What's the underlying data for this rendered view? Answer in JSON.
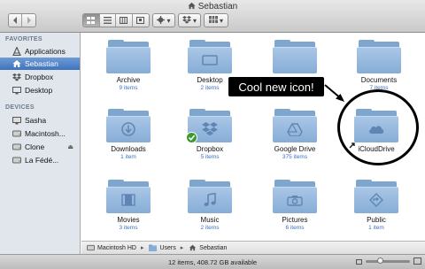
{
  "window": {
    "title": "Sebastian"
  },
  "toolbar": {
    "back_icon": "chevron-left-icon",
    "forward_icon": "chevron-right-icon",
    "view_modes": [
      "icon-view-icon",
      "list-view-icon",
      "column-view-icon",
      "cover-flow-icon"
    ],
    "action_icon": "gear-icon",
    "dropbox_icon": "dropbox-icon",
    "arrange_icon": "arrange-icon"
  },
  "sidebar": {
    "favorites_header": "FAVORITES",
    "favorites": [
      {
        "label": "Applications",
        "icon": "applications-icon"
      },
      {
        "label": "Sebastian",
        "icon": "home-icon",
        "selected": true
      },
      {
        "label": "Dropbox",
        "icon": "dropbox-icon"
      },
      {
        "label": "Desktop",
        "icon": "desktop-icon"
      }
    ],
    "devices_header": "DEVICES",
    "devices": [
      {
        "label": "Sasha",
        "icon": "computer-icon"
      },
      {
        "label": "Macintosh...",
        "icon": "hard-drive-icon"
      },
      {
        "label": "Clone",
        "icon": "hard-drive-icon",
        "eject": "⏏"
      },
      {
        "label": "La Fédé...",
        "icon": "hard-drive-icon"
      }
    ]
  },
  "items": [
    {
      "name": "Archive",
      "sub": "9 items",
      "glyph": ""
    },
    {
      "name": "Desktop",
      "sub": "2 items",
      "glyph": "desktop"
    },
    {
      "name": "",
      "sub": "",
      "glyph": ""
    },
    {
      "name": "Documents",
      "sub": "7 items",
      "glyph": ""
    },
    {
      "name": "Downloads",
      "sub": "1 item",
      "glyph": "download"
    },
    {
      "name": "Dropbox",
      "sub": "5 items",
      "glyph": "dropbox"
    },
    {
      "name": "Google Drive",
      "sub": "375 items",
      "glyph": "drive"
    },
    {
      "name": "iCloudDrive",
      "sub": "",
      "glyph": "cloud"
    },
    {
      "name": "Movies",
      "sub": "3 items",
      "glyph": "film"
    },
    {
      "name": "Music",
      "sub": "2 items",
      "glyph": "music"
    },
    {
      "name": "Pictures",
      "sub": "6 items",
      "glyph": "camera"
    },
    {
      "name": "Public",
      "sub": "1 item",
      "glyph": "public"
    }
  ],
  "callout": {
    "text": "Cool new icon!"
  },
  "pathbar": {
    "crumbs": [
      "Macintosh HD",
      "Users",
      "Sebastian"
    ]
  },
  "status": {
    "text": "12 items, 408.72 GB available",
    "zoom_fraction": 0.3
  }
}
